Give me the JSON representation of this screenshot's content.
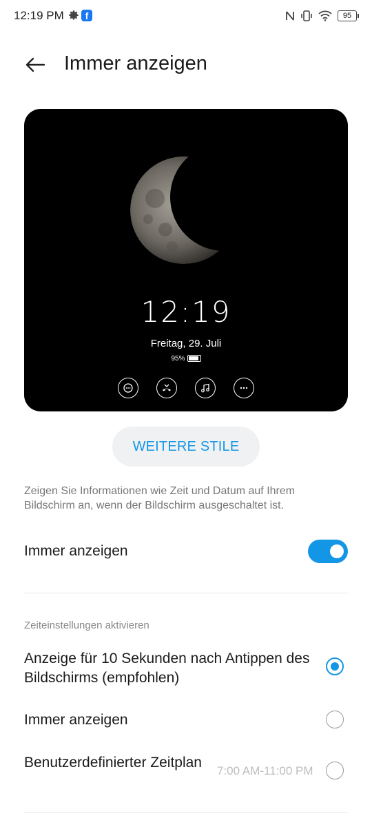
{
  "status_bar": {
    "time": "12:19 PM",
    "battery": "95",
    "icons": [
      "gear-icon",
      "facebook-icon",
      "nfc-icon",
      "vibrate-icon",
      "wifi-icon",
      "battery-icon"
    ]
  },
  "header": {
    "title": "Immer anzeigen",
    "back_icon": "back-arrow-icon"
  },
  "preview": {
    "time": "12:19",
    "date": "Freitag, 29. Juli",
    "battery": "95%",
    "icons": [
      "message-icon",
      "missed-call-icon",
      "music-icon",
      "more-icon"
    ]
  },
  "more_styles_label": "WEITERE STILE",
  "description": "Zeigen Sie Informationen wie Zeit und Datum auf Ihrem Bildschirm an, wenn der Bildschirm ausgeschaltet ist.",
  "toggle_row": {
    "label": "Immer anzeigen",
    "enabled": true
  },
  "time_section": {
    "header": "Zeiteinstellungen aktivieren",
    "options": [
      {
        "label": "Anzeige für 10 Sekunden nach Antippen des Bildschirms (empfohlen)",
        "selected": true
      },
      {
        "label": "Immer anzeigen",
        "selected": false
      },
      {
        "label": "Benutzerdefinierter Zeitplan",
        "selected": false,
        "schedule": "7:00 AM-11:00 PM"
      }
    ]
  },
  "colors": {
    "accent": "#1496e6",
    "preview_background": "#000000"
  }
}
